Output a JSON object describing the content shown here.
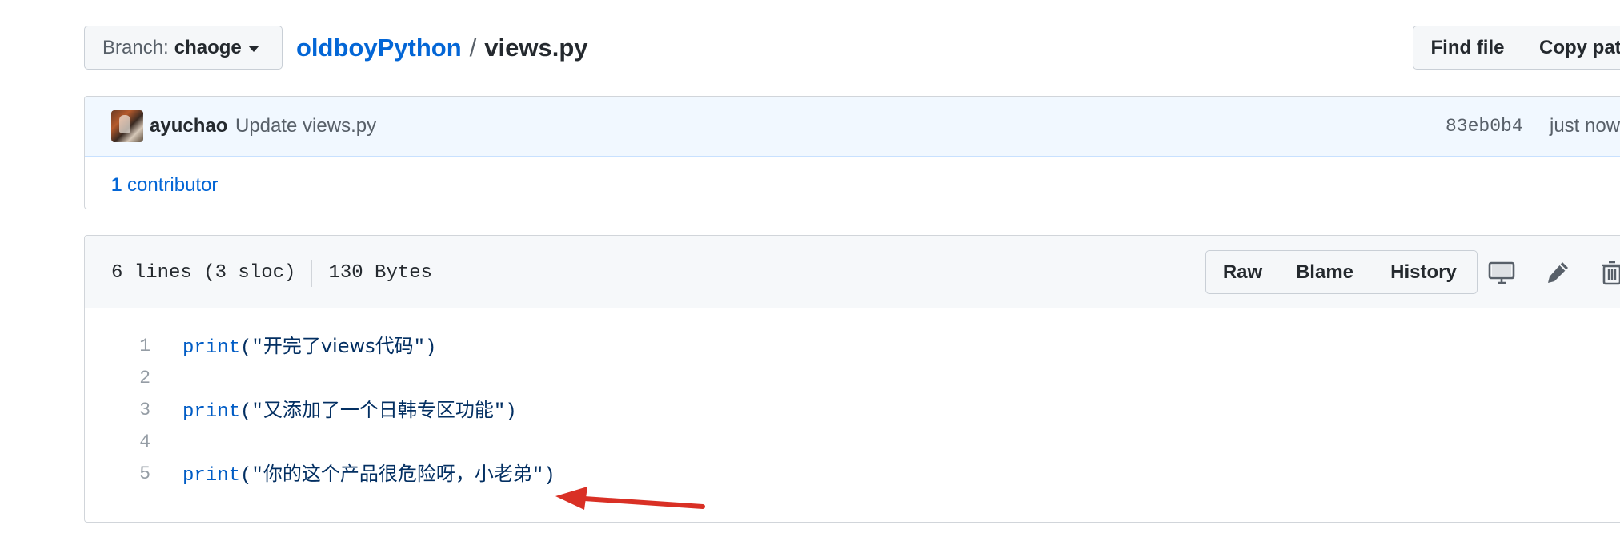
{
  "branch": {
    "prefix": "Branch:",
    "name": "chaoge"
  },
  "breadcrumb": {
    "repo": "oldboyPython",
    "separator": "/",
    "file": "views.py"
  },
  "toolbar": {
    "find_file": "Find file",
    "copy_path": "Copy path"
  },
  "commit": {
    "author": "ayuchao",
    "message": "Update views.py",
    "sha": "83eb0b4",
    "time": "just now"
  },
  "contributors": {
    "count": "1",
    "label": "contributor"
  },
  "file": {
    "lines_info": "6 lines (3 sloc)",
    "size": "130 Bytes",
    "actions": {
      "raw": "Raw",
      "blame": "Blame",
      "history": "History"
    },
    "icons": [
      "desktop-icon",
      "pencil-icon",
      "trash-icon"
    ]
  },
  "code": {
    "lines": [
      {
        "num": "1",
        "fn": "print",
        "open": "(\"",
        "text": "开完了views代码",
        "close": "\")"
      },
      {
        "num": "2",
        "fn": "",
        "open": "",
        "text": "",
        "close": ""
      },
      {
        "num": "3",
        "fn": "print",
        "open": "(\"",
        "text": "又添加了一个日韩专区功能",
        "close": "\")"
      },
      {
        "num": "4",
        "fn": "",
        "open": "",
        "text": "",
        "close": ""
      },
      {
        "num": "5",
        "fn": "print",
        "open": "(\"",
        "text": "你的这个产品很危险呀，小老弟",
        "close": "\")"
      }
    ]
  },
  "colors": {
    "link": "#0366d6",
    "annotation_arrow": "#d93025",
    "code_keyword": "#005cc5",
    "code_string": "#032f62"
  }
}
